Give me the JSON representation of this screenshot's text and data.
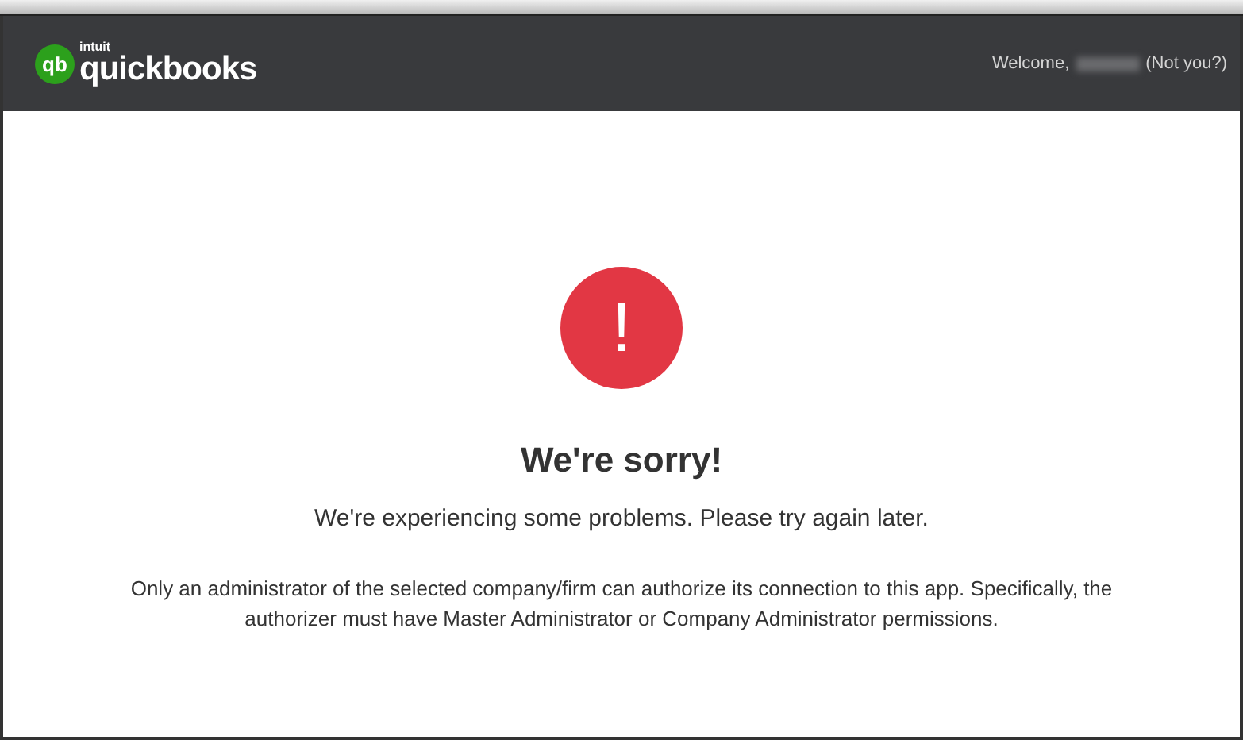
{
  "header": {
    "logo": {
      "brand": "intuit",
      "product": "quickbooks",
      "mark": "qb"
    },
    "welcome": "Welcome,",
    "not_you": "(Not you?)"
  },
  "error": {
    "icon": "!",
    "title": "We're sorry!",
    "message": "We're experiencing some problems. Please try again later.",
    "details": "Only an administrator of the selected company/firm can authorize its connection to this app. Specifically, the authorizer must have Master Administrator or Company Administrator permissions."
  }
}
